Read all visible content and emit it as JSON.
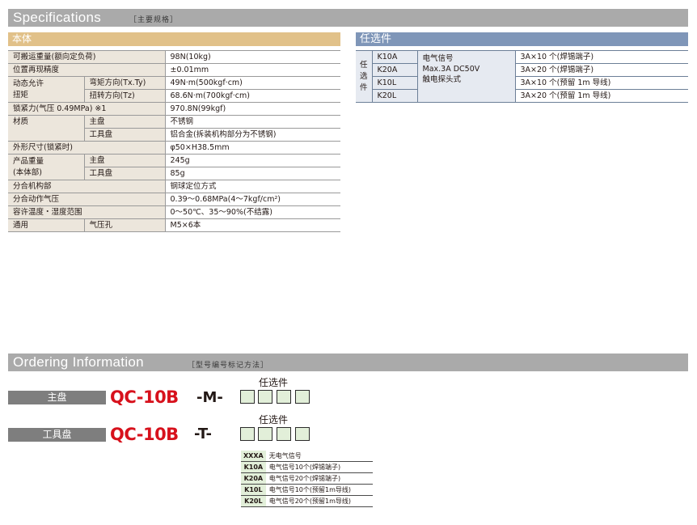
{
  "specifications": {
    "title": "Specifications",
    "subtitle": "［主要规格］",
    "body_header": "本体",
    "body_header_color": "#e1c189",
    "rows": [
      {
        "label": "可搬运重量(额向定负荷)",
        "value": "98N(10kg)"
      },
      {
        "label": "位置再现精度",
        "value": "±0.01mm"
      },
      {
        "label": "动态允许\n扭矩",
        "sub": "弯矩方向(Tx.Ty)",
        "value": "49N·m(500kgf·cm)"
      },
      {
        "sub": "扭转方向(Tz)",
        "value": "68.6N·m(700kgf·cm)"
      },
      {
        "label": "锁紧力(气压 0.49MPa) ※1",
        "value": "970.8N(99kgf)"
      },
      {
        "label": "材质",
        "sub": "主盘",
        "value": "不锈钢"
      },
      {
        "sub": "工具盘",
        "value": "铝合金(拆装机构部分为不锈钢)"
      },
      {
        "label": "外形尺寸(锁紧时)",
        "value": "φ50×H38.5mm"
      },
      {
        "label": "产品重量\n(本体部)",
        "sub": "主盘",
        "value": "245g"
      },
      {
        "sub": "工具盘",
        "value": "85g"
      },
      {
        "label": "分合机构部",
        "value": "钢球定位方式"
      },
      {
        "label": "分合动作气压",
        "value": "0.39～0.68MPa(4～7kgf/cm²)"
      },
      {
        "label": "容许温度・湿度范围",
        "value": "0～50℃、35～90%(不结露)"
      },
      {
        "label": "通用",
        "sub": "气压孔",
        "value": "M5×6本"
      }
    ]
  },
  "options": {
    "header": "任选件",
    "header_color": "#7f96b8",
    "group_label": [
      "任",
      "选",
      "件"
    ],
    "desc": [
      "电气信号",
      "Max.3A DC50V",
      "触电探头式"
    ],
    "rows": [
      {
        "code": "K10A",
        "spec": "3A×10 个(焊锡端子)"
      },
      {
        "code": "K20A",
        "spec": "3A×20 个(焊锡端子)"
      },
      {
        "code": "K10L",
        "spec": "3A×10 个(预留 1m 导线)"
      },
      {
        "code": "K20L",
        "spec": "3A×20 个(预留 1m 导线)"
      }
    ]
  },
  "ordering": {
    "title": "Ordering Information",
    "subtitle": "［型号编号标记方法］",
    "model_color": "#d7111c",
    "master": {
      "label": "主盘",
      "model": "QC-10B",
      "suffix": "-M-",
      "option_title": "任选件"
    },
    "tool": {
      "label": "工具盘",
      "model": "QC-10B",
      "suffix": "-T-",
      "option_title": "任选件"
    },
    "codes": [
      {
        "code": "XXXA",
        "desc": "无电气信号"
      },
      {
        "code": "K10A",
        "desc": "电气信号10个(焊锡端子)"
      },
      {
        "code": "K20A",
        "desc": "电气信号20个(焊锡端子)"
      },
      {
        "code": "K10L",
        "desc": "电气信号10个(预留1m导线)"
      },
      {
        "code": "K20L",
        "desc": "电气信号20个(预留1m导线)"
      }
    ]
  }
}
